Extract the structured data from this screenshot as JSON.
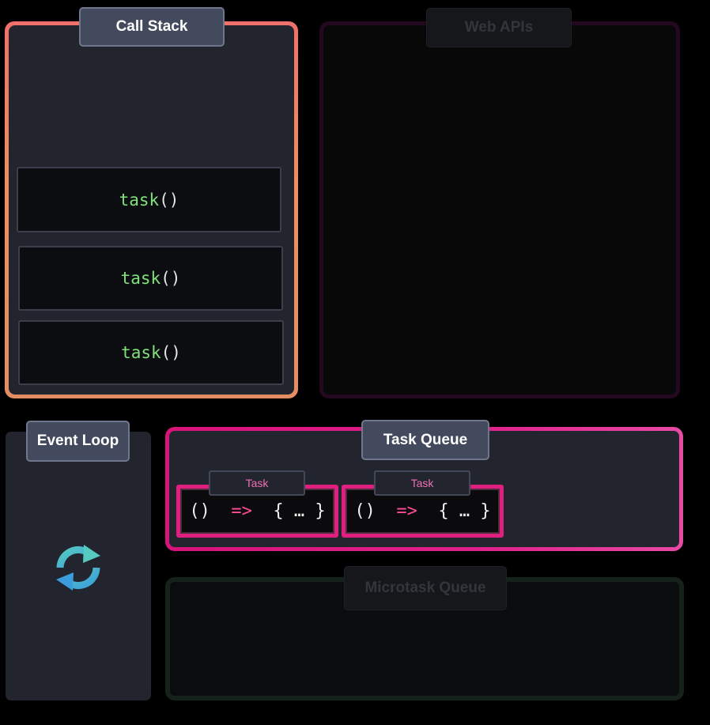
{
  "call_stack": {
    "title": "Call Stack",
    "frames": [
      {
        "fn": "task",
        "parens": "()"
      },
      {
        "fn": "task",
        "parens": "()"
      },
      {
        "fn": "task",
        "parens": "()"
      }
    ]
  },
  "web_apis": {
    "title": "Web APIs"
  },
  "event_loop": {
    "title": "Event Loop",
    "icon": "refresh-cycle-icon"
  },
  "task_queue": {
    "title": "Task Queue",
    "tasks": [
      {
        "label": "Task",
        "open": "()",
        "arrow": "=>",
        "body": "{ … }"
      },
      {
        "label": "Task",
        "open": "()",
        "arrow": "=>",
        "body": "{ … }"
      }
    ]
  },
  "microtask_queue": {
    "title": "Microtask Queue"
  },
  "colors": {
    "call_stack_border": "#f0716a",
    "task_queue_border": "#e0207f",
    "code_function": "#7fe27a",
    "arrow": "#ff4d97",
    "event_loop_icon": "#4fb7d9"
  }
}
